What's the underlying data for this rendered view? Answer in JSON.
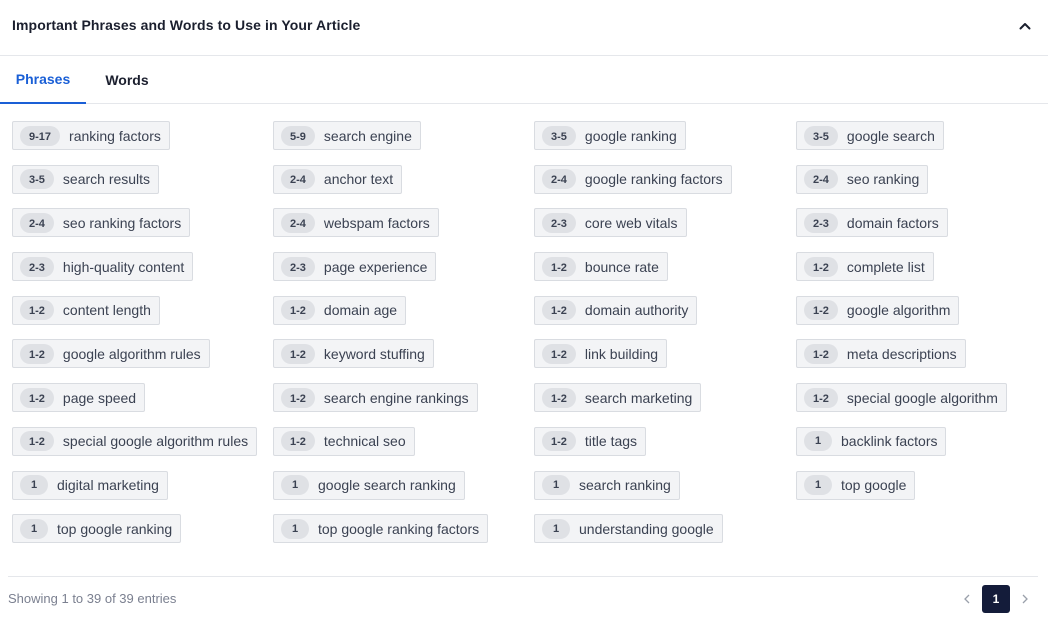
{
  "header": {
    "title": "Important Phrases and Words to Use in Your Article",
    "collapse_icon": "chevron-up-icon"
  },
  "tabs": [
    {
      "label": "Phrases",
      "active": true
    },
    {
      "label": "Words",
      "active": false
    }
  ],
  "phrases": [
    {
      "range": "9-17",
      "text": "ranking factors"
    },
    {
      "range": "5-9",
      "text": "search engine"
    },
    {
      "range": "3-5",
      "text": "google ranking"
    },
    {
      "range": "3-5",
      "text": "google search"
    },
    {
      "range": "3-5",
      "text": "search results"
    },
    {
      "range": "2-4",
      "text": "anchor text"
    },
    {
      "range": "2-4",
      "text": "google ranking factors"
    },
    {
      "range": "2-4",
      "text": "seo ranking"
    },
    {
      "range": "2-4",
      "text": "seo ranking factors"
    },
    {
      "range": "2-4",
      "text": "webspam factors"
    },
    {
      "range": "2-3",
      "text": "core web vitals"
    },
    {
      "range": "2-3",
      "text": "domain factors"
    },
    {
      "range": "2-3",
      "text": "high-quality content"
    },
    {
      "range": "2-3",
      "text": "page experience"
    },
    {
      "range": "1-2",
      "text": "bounce rate"
    },
    {
      "range": "1-2",
      "text": "complete list"
    },
    {
      "range": "1-2",
      "text": "content length"
    },
    {
      "range": "1-2",
      "text": "domain age"
    },
    {
      "range": "1-2",
      "text": "domain authority"
    },
    {
      "range": "1-2",
      "text": "google algorithm"
    },
    {
      "range": "1-2",
      "text": "google algorithm rules"
    },
    {
      "range": "1-2",
      "text": "keyword stuffing"
    },
    {
      "range": "1-2",
      "text": "link building"
    },
    {
      "range": "1-2",
      "text": "meta descriptions"
    },
    {
      "range": "1-2",
      "text": "page speed"
    },
    {
      "range": "1-2",
      "text": "search engine rankings"
    },
    {
      "range": "1-2",
      "text": "search marketing"
    },
    {
      "range": "1-2",
      "text": "special google algorithm"
    },
    {
      "range": "1-2",
      "text": "special google algorithm rules"
    },
    {
      "range": "1-2",
      "text": "technical seo"
    },
    {
      "range": "1-2",
      "text": "title tags"
    },
    {
      "range": "1",
      "text": "backlink factors"
    },
    {
      "range": "1",
      "text": "digital marketing"
    },
    {
      "range": "1",
      "text": "google search ranking"
    },
    {
      "range": "1",
      "text": "search ranking"
    },
    {
      "range": "1",
      "text": "top google"
    },
    {
      "range": "1",
      "text": "top google ranking"
    },
    {
      "range": "1",
      "text": "top google ranking factors"
    },
    {
      "range": "1",
      "text": "understanding google"
    }
  ],
  "footer": {
    "info": "Showing 1 to 39 of 39 entries",
    "prev_icon": "chevron-left-icon",
    "next_icon": "chevron-right-icon",
    "current_page": "1"
  },
  "colors": {
    "accent": "#1a5fd6",
    "active_page_bg": "#141c3a"
  }
}
